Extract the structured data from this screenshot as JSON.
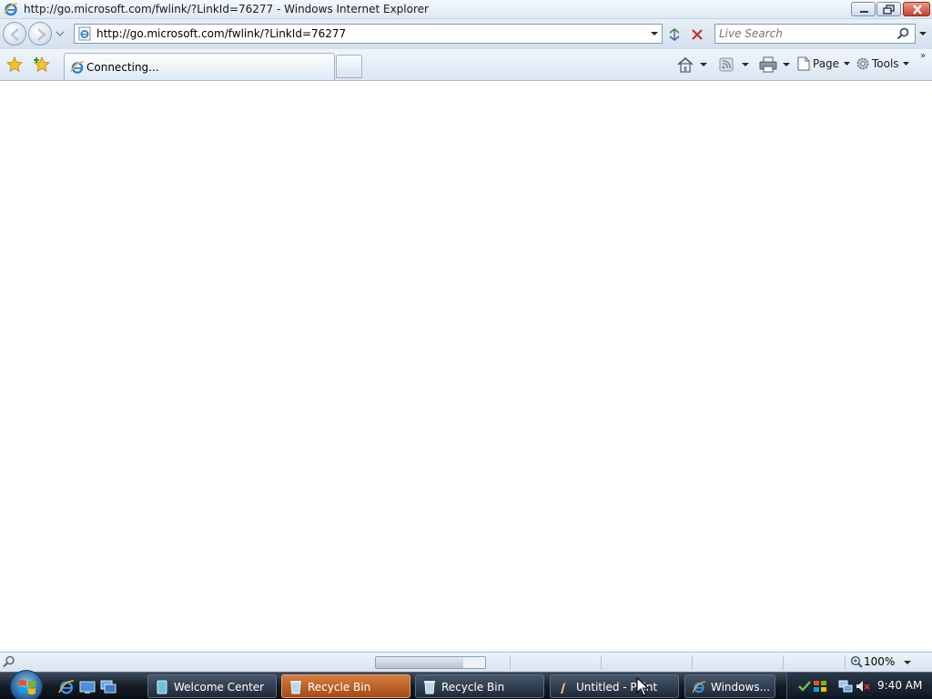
{
  "window": {
    "title": "http://go.microsoft.com/fwlink/?LinkId=76277 - Windows Internet Explorer",
    "controls": {
      "minimize": "minimize-icon",
      "maximize": "restore-icon",
      "close": "close-icon"
    }
  },
  "navigation": {
    "address_url": "http://go.microsoft.com/fwlink/?LinkId=76277",
    "search_placeholder": "Live Search"
  },
  "tabs": [
    {
      "label": "Connecting...",
      "active": true
    }
  ],
  "command_bar": {
    "page_label": "Page",
    "tools_label": "Tools",
    "more_label": "»"
  },
  "status_bar": {
    "zoom_label": "100%",
    "progress_fraction": 0.8
  },
  "taskbar": {
    "tasks": [
      {
        "label": "Welcome Center",
        "icon": "welcome-center-icon",
        "active": false
      },
      {
        "label": "Recycle Bin",
        "icon": "recycle-bin-icon",
        "active": true
      },
      {
        "label": "Recycle Bin",
        "icon": "recycle-bin-icon",
        "active": false
      },
      {
        "label": "Untitled - Paint",
        "icon": "paint-icon",
        "active": false
      },
      {
        "label": "Windows...",
        "icon": "ie-icon",
        "active": false
      }
    ],
    "clock": "9:40 AM"
  },
  "colors": {
    "chrome": "#dbe6f1",
    "taskbar": "#141c26",
    "active_task": "#d97c3c",
    "close_button": "#c5432d"
  }
}
